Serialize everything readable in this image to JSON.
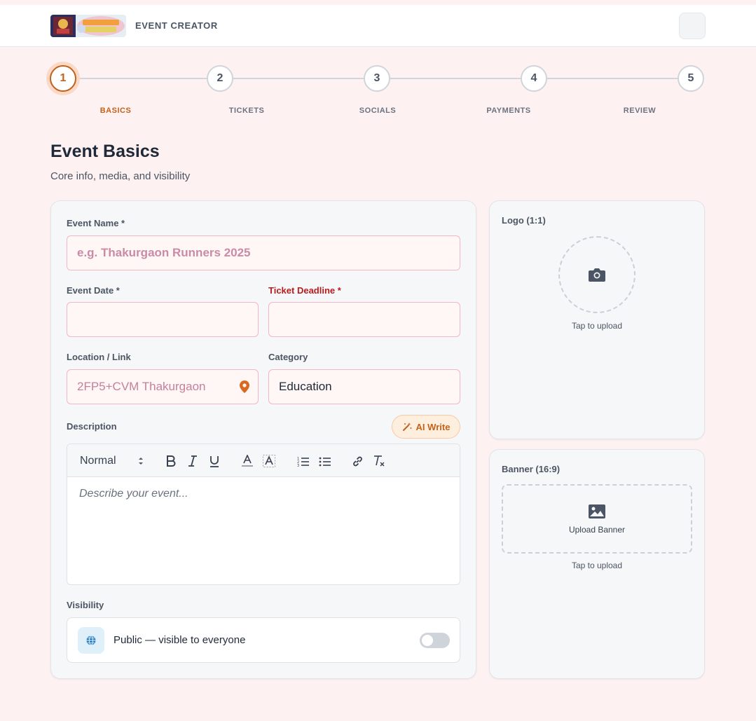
{
  "header": {
    "brand_title": "EVENT CREATOR",
    "logo_alt": "SAMAN EVENTS"
  },
  "stepper": {
    "active_step": 1,
    "steps": [
      {
        "number": "1",
        "label": "BASICS"
      },
      {
        "number": "2",
        "label": "TICKETS"
      },
      {
        "number": "3",
        "label": "SOCIALS"
      },
      {
        "number": "4",
        "label": "PAYMENTS"
      },
      {
        "number": "5",
        "label": "REVIEW"
      }
    ]
  },
  "page": {
    "title": "Event Basics",
    "subtitle": "Core info, media, and visibility"
  },
  "form": {
    "event_name": {
      "label": "Event Name *",
      "placeholder": "e.g. Thakurgaon Runners 2025",
      "value": ""
    },
    "event_date": {
      "label": "Event Date *",
      "value": ""
    },
    "ticket_deadline": {
      "label": "Ticket Deadline *",
      "value": ""
    },
    "location": {
      "label": "Location / Link",
      "placeholder": "2FP5+CVM Thakurgaon",
      "icon": "map-pin-icon"
    },
    "category": {
      "label": "Category",
      "value": "Education"
    },
    "description": {
      "label": "Description",
      "ai_button": "AI Write",
      "format_select": "Normal",
      "placeholder": "Describe your event..."
    },
    "visibility": {
      "label": "Visibility",
      "text": "Public — visible to everyone",
      "toggle_on": false
    }
  },
  "media": {
    "logo": {
      "label": "Logo (1:1)",
      "hint": "Tap to upload",
      "icon": "camera-icon"
    },
    "banner": {
      "label": "Banner (16:9)",
      "button": "Upload Banner",
      "hint": "Tap to upload",
      "icon": "image-icon"
    }
  },
  "colors": {
    "accent": "#c2621a",
    "background": "#fdf1f1",
    "input_border": "#f2b7c4",
    "required_red": "#b91c1c"
  }
}
